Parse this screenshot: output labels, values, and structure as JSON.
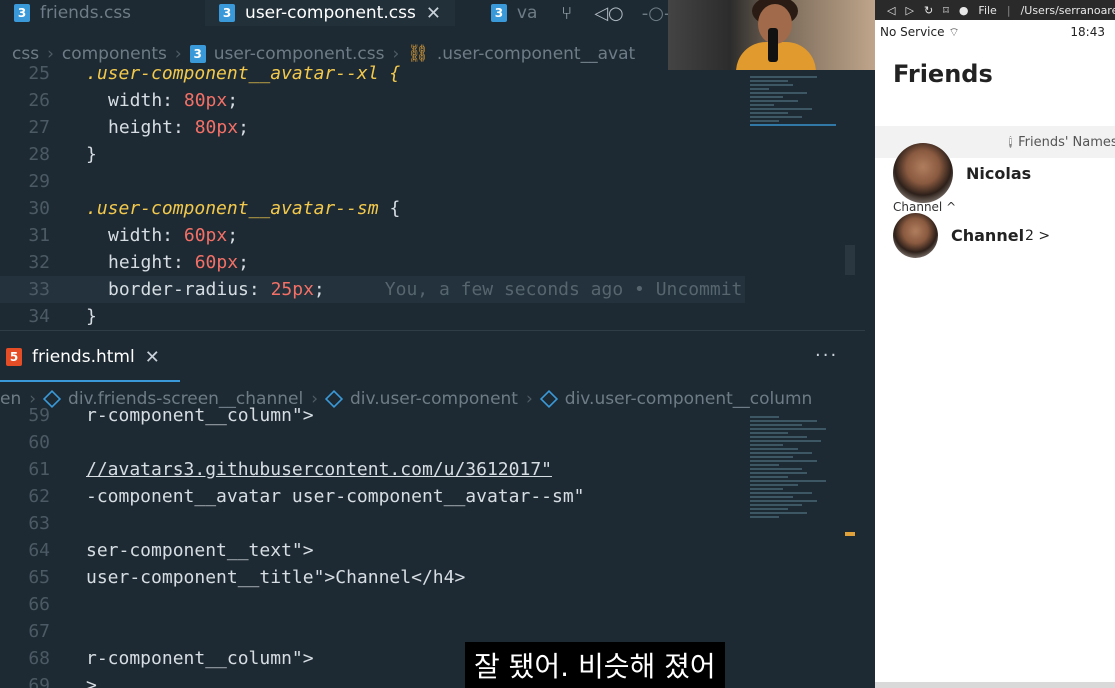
{
  "top_tabs": [
    {
      "label": "friends.css"
    },
    {
      "label": "user-component.css",
      "close": "✕"
    },
    {
      "label": "va"
    }
  ],
  "top_breadcrumb": [
    "css",
    "components",
    "user-component.css",
    ".user-component__avat"
  ],
  "css_lines": [
    {
      "n": "25",
      "sel": ".user-component__avatar--xl {"
    },
    {
      "n": "26",
      "prop": "width: ",
      "num": "80px",
      "end": ";"
    },
    {
      "n": "27",
      "prop": "height: ",
      "num": "80px",
      "end": ";"
    },
    {
      "n": "28",
      "brace": "}"
    },
    {
      "n": "29"
    },
    {
      "n": "30",
      "sel": ".user-component__avatar--sm",
      "brace": " {"
    },
    {
      "n": "31",
      "prop": "width: ",
      "num": "60px",
      "end": ";"
    },
    {
      "n": "32",
      "prop": "height: ",
      "num": "60px",
      "end": ";"
    },
    {
      "n": "33",
      "prop": "border-radius: ",
      "num": "25px",
      "end": ";",
      "ghost": "You, a few seconds ago • Uncommit"
    },
    {
      "n": "34",
      "brace": "}"
    }
  ],
  "bottom_tab": {
    "label": "friends.html",
    "close": "✕",
    "more": "···"
  },
  "bottom_breadcrumb": [
    "en",
    "div.friends-screen__channel",
    "div.user-component",
    "div.user-component__column"
  ],
  "html_lines": [
    {
      "n": "59",
      "text": "r-component__column\">"
    },
    {
      "n": "60",
      "text": ""
    },
    {
      "n": "61",
      "text": "//avatars3.githubusercontent.com/u/3612017\""
    },
    {
      "n": "62",
      "text": "-component__avatar user-component__avatar--sm\""
    },
    {
      "n": "63",
      "text": ""
    },
    {
      "n": "64",
      "text": "ser-component__text\">"
    },
    {
      "n": "65",
      "text": "user-component__title\">Channel</h4>"
    },
    {
      "n": "66",
      "text": ""
    },
    {
      "n": "67",
      "text": ""
    },
    {
      "n": "68",
      "text": "r-component__column\">"
    },
    {
      "n": "69",
      "text": ">"
    }
  ],
  "subtitle": "잘 됐어. 비슷해 졌어",
  "simulator": {
    "toolbar_file": "File",
    "toolbar_path": "/Users/serranoare",
    "carrier": "No Service",
    "time": "18:43",
    "title": "Friends",
    "names_label": "Friends' Names",
    "friend_name": "Nicolas",
    "channel_label": "Channel ^",
    "channel_name": "Channel",
    "channel_count": "2 >"
  }
}
